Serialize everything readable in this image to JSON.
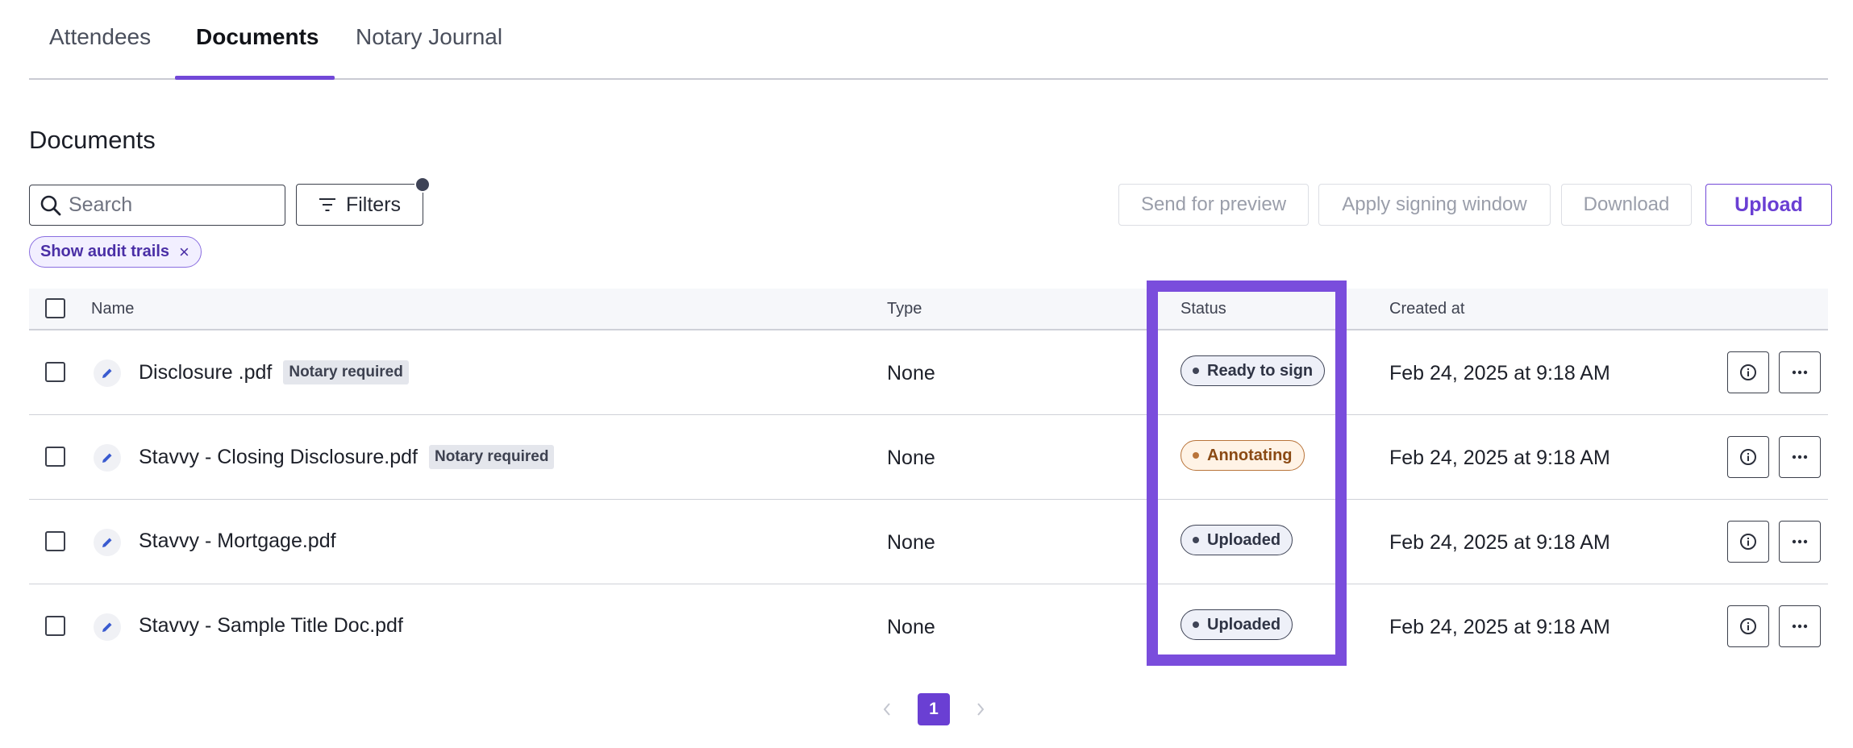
{
  "tabs": [
    {
      "label": "Attendees",
      "active": false
    },
    {
      "label": "Documents",
      "active": true
    },
    {
      "label": "Notary Journal",
      "active": false
    }
  ],
  "section_title": "Documents",
  "toolbar": {
    "search_placeholder": "Search",
    "filters_label": "Filters",
    "send_preview_label": "Send for preview",
    "apply_signing_label": "Apply signing window",
    "download_label": "Download",
    "upload_label": "Upload"
  },
  "active_filter_chip": {
    "label": "Show audit trails",
    "close_glyph": "×"
  },
  "table": {
    "columns": {
      "name": "Name",
      "type": "Type",
      "status": "Status",
      "created": "Created at"
    },
    "rows": [
      {
        "name": "Disclosure .pdf",
        "badge": "Notary required",
        "type": "None",
        "status": "Ready to sign",
        "created": "Feb 24, 2025 at 9:18 AM"
      },
      {
        "name": "Stavvy - Closing Disclosure.pdf",
        "badge": "Notary required",
        "type": "None",
        "status": "Annotating",
        "created": "Feb 24, 2025 at 9:18 AM"
      },
      {
        "name": "Stavvy - Mortgage.pdf",
        "badge": "",
        "type": "None",
        "status": "Uploaded",
        "created": "Feb 24, 2025 at 9:18 AM"
      },
      {
        "name": "Stavvy - Sample Title Doc.pdf",
        "badge": "",
        "type": "None",
        "status": "Uploaded",
        "created": "Feb 24, 2025 at 9:18 AM"
      }
    ]
  },
  "pagination": {
    "current_page": "1"
  },
  "icons": [
    "search-icon",
    "filter-icon",
    "close-icon",
    "pencil-icon",
    "info-icon",
    "more-icon",
    "chevron-left-icon",
    "chevron-right-icon"
  ],
  "colors": {
    "accent": "#7248d8",
    "highlight": "#7a4ddc",
    "annotating": "#b9743a"
  }
}
